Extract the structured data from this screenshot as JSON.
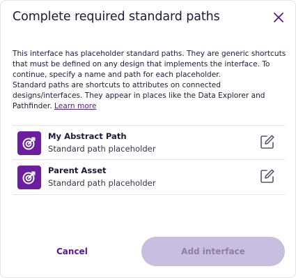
{
  "dialog": {
    "title": "Complete required standard paths",
    "description_1": "This interface has placeholder standard paths. They are generic shortcuts that must be defined on any design that implements the interface. To continue, specify a name and path for each placeholder.",
    "description_2_text": "Standard paths are shortcuts to attributes on connected designs/interfaces. They appear in places like the Data Explorer and Pathfinder. ",
    "learn_more": "Learn more",
    "close_icon": "close-icon"
  },
  "placeholders": [
    {
      "name": "My Abstract Path",
      "subtitle": "Standard path placeholder",
      "icon": "standard-path-icon",
      "edit_icon": "edit-icon"
    },
    {
      "name": "Parent Asset",
      "subtitle": "Standard path placeholder",
      "icon": "standard-path-icon",
      "edit_icon": "edit-icon"
    }
  ],
  "footer": {
    "cancel_label": "Cancel",
    "primary_label": "Add interface",
    "primary_disabled": true
  },
  "colors": {
    "accent": "#5b1590",
    "icon_bg": "#6b1e9e",
    "disabled_button_bg": "#c8bfe0",
    "disabled_button_text": "#8b7faa",
    "text": "#22183a"
  }
}
